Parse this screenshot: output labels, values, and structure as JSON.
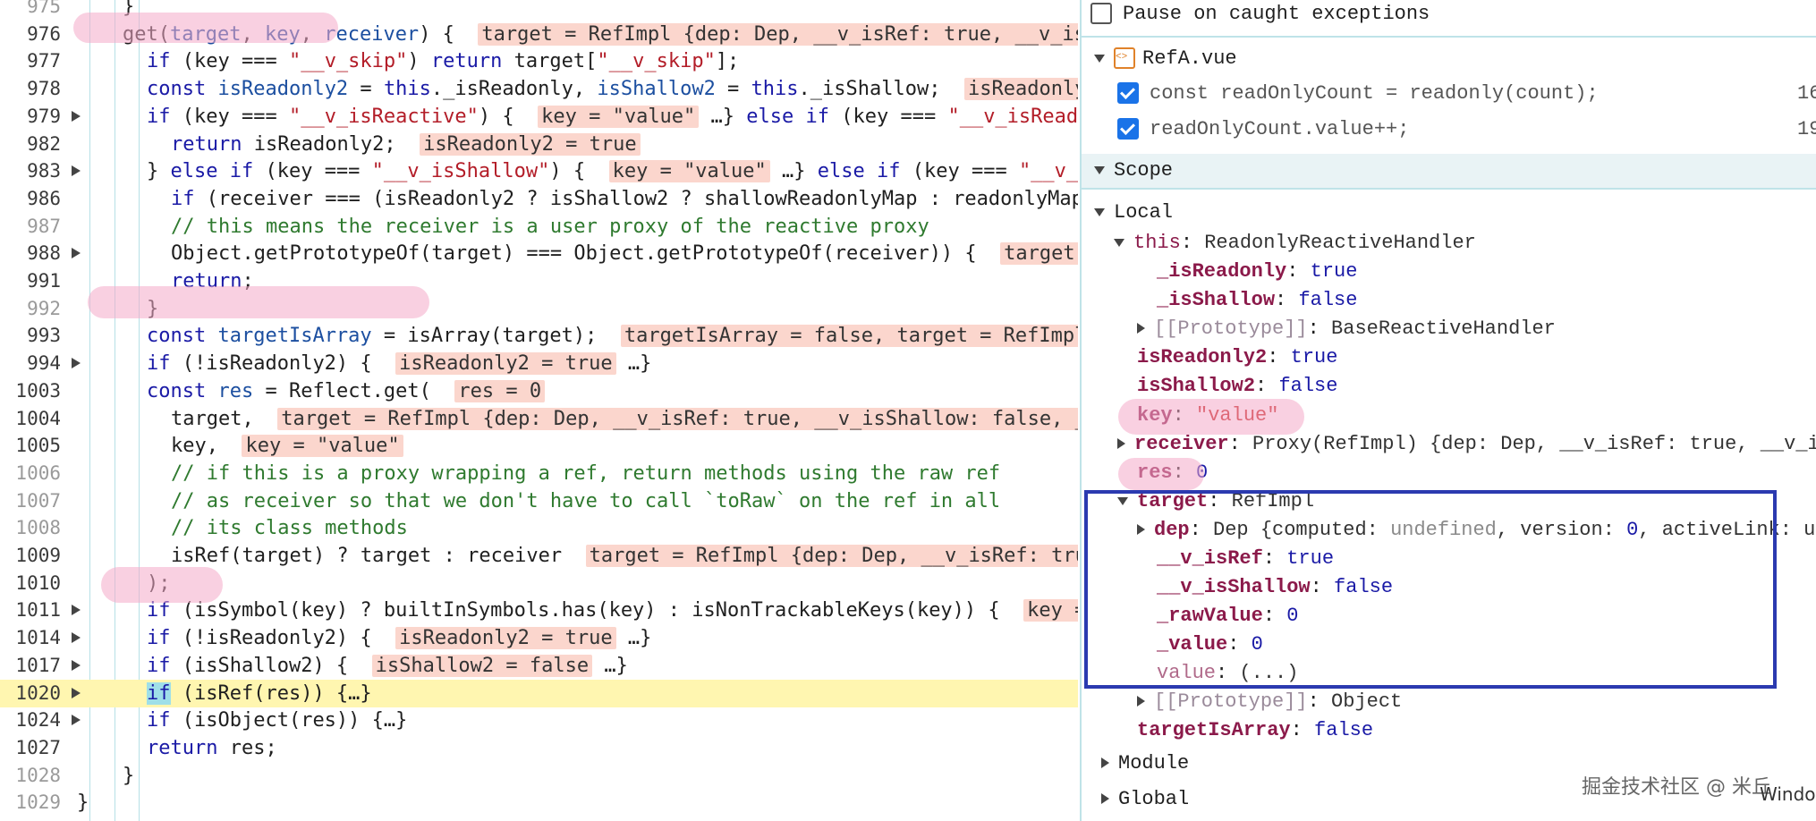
{
  "editor": {
    "lines": [
      {
        "n": "975",
        "dim": true,
        "fold": false,
        "indent": 0,
        "segs": [
          {
            "t": "}",
            "c": ""
          }
        ]
      },
      {
        "n": "976",
        "dim": false,
        "fold": false,
        "indent": 0,
        "segs": [
          {
            "t": "get(",
            "c": ""
          },
          {
            "t": "target",
            "c": "id"
          },
          {
            "t": ", ",
            "c": ""
          },
          {
            "t": "key",
            "c": "id"
          },
          {
            "t": ", ",
            "c": ""
          },
          {
            "t": "receiver",
            "c": "id"
          },
          {
            "t": ") {  ",
            "c": ""
          },
          {
            "t": "target = RefImpl {dep: Dep, __v_isRef: true, __v_is",
            "c": "val"
          }
        ]
      },
      {
        "n": "977",
        "dim": false,
        "fold": false,
        "indent": 1,
        "segs": [
          {
            "t": "if",
            "c": "kw"
          },
          {
            "t": " (key === ",
            "c": ""
          },
          {
            "t": "\"__v_skip\"",
            "c": "str"
          },
          {
            "t": ") ",
            "c": ""
          },
          {
            "t": "return",
            "c": "kw"
          },
          {
            "t": " target[",
            "c": ""
          },
          {
            "t": "\"__v_skip\"",
            "c": "str"
          },
          {
            "t": "];",
            "c": ""
          }
        ]
      },
      {
        "n": "978",
        "dim": false,
        "fold": false,
        "indent": 1,
        "segs": [
          {
            "t": "const",
            "c": "kw"
          },
          {
            "t": " ",
            "c": ""
          },
          {
            "t": "isReadonly2",
            "c": "id"
          },
          {
            "t": " = ",
            "c": ""
          },
          {
            "t": "this",
            "c": "kw"
          },
          {
            "t": "._isReadonly, ",
            "c": ""
          },
          {
            "t": "isShallow2",
            "c": "id"
          },
          {
            "t": " = ",
            "c": ""
          },
          {
            "t": "this",
            "c": "kw"
          },
          {
            "t": "._isShallow;  ",
            "c": ""
          },
          {
            "t": "isReadonly",
            "c": "val"
          }
        ]
      },
      {
        "n": "979",
        "dim": false,
        "fold": true,
        "indent": 1,
        "segs": [
          {
            "t": "if",
            "c": "kw"
          },
          {
            "t": " (key === ",
            "c": ""
          },
          {
            "t": "\"__v_isReactive\"",
            "c": "str"
          },
          {
            "t": ") {  ",
            "c": ""
          },
          {
            "t": "key = \"value\"",
            "c": "val"
          },
          {
            "t": " …} ",
            "c": ""
          },
          {
            "t": "else if",
            "c": "kw"
          },
          {
            "t": " (key === ",
            "c": ""
          },
          {
            "t": "\"__v_isRead",
            "c": "str"
          }
        ]
      },
      {
        "n": "982",
        "dim": false,
        "fold": false,
        "indent": 2,
        "segs": [
          {
            "t": "return",
            "c": "kw"
          },
          {
            "t": " isReadonly2;  ",
            "c": ""
          },
          {
            "t": "isReadonly2 = true",
            "c": "val"
          }
        ]
      },
      {
        "n": "983",
        "dim": false,
        "fold": true,
        "indent": 1,
        "segs": [
          {
            "t": "} ",
            "c": ""
          },
          {
            "t": "else if",
            "c": "kw"
          },
          {
            "t": " (key === ",
            "c": ""
          },
          {
            "t": "\"__v_isShallow\"",
            "c": "str"
          },
          {
            "t": ") {  ",
            "c": ""
          },
          {
            "t": "key = \"value\"",
            "c": "val"
          },
          {
            "t": " …} ",
            "c": ""
          },
          {
            "t": "else if",
            "c": "kw"
          },
          {
            "t": " (key === ",
            "c": ""
          },
          {
            "t": "\"__v_",
            "c": "str"
          }
        ]
      },
      {
        "n": "986",
        "dim": false,
        "fold": false,
        "indent": 2,
        "segs": [
          {
            "t": "if",
            "c": "kw"
          },
          {
            "t": " (receiver === (isReadonly2 ? isShallow2 ? shallowReadonlyMap : readonlyMap",
            "c": ""
          }
        ]
      },
      {
        "n": "987",
        "dim": true,
        "fold": false,
        "indent": 2,
        "segs": [
          {
            "t": "// this means the receiver is a user proxy of the reactive proxy",
            "c": "com"
          }
        ]
      },
      {
        "n": "988",
        "dim": false,
        "fold": true,
        "indent": 2,
        "segs": [
          {
            "t": "Object.getPrototypeOf(target) === Object.getPrototypeOf(receiver)) {  ",
            "c": ""
          },
          {
            "t": "target",
            "c": "val"
          }
        ]
      },
      {
        "n": "991",
        "dim": false,
        "fold": false,
        "indent": 2,
        "segs": [
          {
            "t": "return",
            "c": "kw"
          },
          {
            "t": ";",
            "c": ""
          }
        ]
      },
      {
        "n": "992",
        "dim": true,
        "fold": false,
        "indent": 1,
        "segs": [
          {
            "t": "}",
            "c": ""
          }
        ]
      },
      {
        "n": "993",
        "dim": false,
        "fold": false,
        "indent": 1,
        "segs": [
          {
            "t": "const",
            "c": "kw"
          },
          {
            "t": " ",
            "c": ""
          },
          {
            "t": "targetIsArray",
            "c": "id"
          },
          {
            "t": " = isArray(target);  ",
            "c": ""
          },
          {
            "t": "targetIsArray = false, target = RefImpl",
            "c": "val"
          }
        ]
      },
      {
        "n": "994",
        "dim": false,
        "fold": true,
        "indent": 1,
        "segs": [
          {
            "t": "if",
            "c": "kw"
          },
          {
            "t": " (!isReadonly2) {  ",
            "c": ""
          },
          {
            "t": "isReadonly2 = true",
            "c": "val"
          },
          {
            "t": " …}",
            "c": ""
          }
        ]
      },
      {
        "n": "1003",
        "dim": false,
        "fold": false,
        "indent": 1,
        "segs": [
          {
            "t": "const",
            "c": "kw"
          },
          {
            "t": " ",
            "c": ""
          },
          {
            "t": "res",
            "c": "id"
          },
          {
            "t": " = Reflect.get(  ",
            "c": ""
          },
          {
            "t": "res = 0",
            "c": "val"
          }
        ]
      },
      {
        "n": "1004",
        "dim": false,
        "fold": false,
        "indent": 2,
        "segs": [
          {
            "t": "target,  ",
            "c": ""
          },
          {
            "t": "target = RefImpl {dep: Dep, __v_isRef: true, __v_isShallow: false, _",
            "c": "val"
          }
        ]
      },
      {
        "n": "1005",
        "dim": false,
        "fold": false,
        "indent": 2,
        "segs": [
          {
            "t": "key,  ",
            "c": ""
          },
          {
            "t": "key = \"value\"",
            "c": "val"
          }
        ]
      },
      {
        "n": "1006",
        "dim": true,
        "fold": false,
        "indent": 2,
        "segs": [
          {
            "t": "// if this is a proxy wrapping a ref, return methods using the raw ref",
            "c": "com"
          }
        ]
      },
      {
        "n": "1007",
        "dim": true,
        "fold": false,
        "indent": 2,
        "segs": [
          {
            "t": "// as receiver so that we don't have to call `toRaw` on the ref in all",
            "c": "com"
          }
        ]
      },
      {
        "n": "1008",
        "dim": true,
        "fold": false,
        "indent": 2,
        "segs": [
          {
            "t": "// its class methods",
            "c": "com"
          }
        ]
      },
      {
        "n": "1009",
        "dim": false,
        "fold": false,
        "indent": 2,
        "segs": [
          {
            "t": "isRef(target) ? target : receiver  ",
            "c": ""
          },
          {
            "t": "target = RefImpl {dep: Dep, __v_isRef: tru",
            "c": "val"
          }
        ]
      },
      {
        "n": "1010",
        "dim": false,
        "fold": false,
        "indent": 1,
        "segs": [
          {
            "t": ");",
            "c": ""
          }
        ]
      },
      {
        "n": "1011",
        "dim": false,
        "fold": true,
        "indent": 1,
        "segs": [
          {
            "t": "if",
            "c": "kw"
          },
          {
            "t": " (isSymbol(key) ? builtInSymbols.has(key) : isNonTrackableKeys(key)) {  ",
            "c": ""
          },
          {
            "t": "key =",
            "c": "val"
          }
        ]
      },
      {
        "n": "1014",
        "dim": false,
        "fold": true,
        "indent": 1,
        "segs": [
          {
            "t": "if",
            "c": "kw"
          },
          {
            "t": " (!isReadonly2) {  ",
            "c": ""
          },
          {
            "t": "isReadonly2 = true",
            "c": "val"
          },
          {
            "t": " …}",
            "c": ""
          }
        ]
      },
      {
        "n": "1017",
        "dim": false,
        "fold": true,
        "indent": 1,
        "segs": [
          {
            "t": "if",
            "c": "kw"
          },
          {
            "t": " (isShallow2) {  ",
            "c": ""
          },
          {
            "t": "isShallow2 = false",
            "c": "val"
          },
          {
            "t": " …}",
            "c": ""
          }
        ]
      },
      {
        "n": "1020",
        "dim": false,
        "fold": true,
        "indent": 1,
        "current": true,
        "segs": [
          {
            "t": "if",
            "c": "sel"
          },
          {
            "t": " (isRef(res)) {…}",
            "c": ""
          }
        ]
      },
      {
        "n": "1024",
        "dim": false,
        "fold": true,
        "indent": 1,
        "segs": [
          {
            "t": "if",
            "c": "kw"
          },
          {
            "t": " (isObject(res)) {…}",
            "c": ""
          }
        ]
      },
      {
        "n": "1027",
        "dim": false,
        "fold": false,
        "indent": 1,
        "segs": [
          {
            "t": "return",
            "c": "kw"
          },
          {
            "t": " res;",
            "c": ""
          }
        ]
      },
      {
        "n": "1028",
        "dim": true,
        "fold": false,
        "indent": 0,
        "segs": [
          {
            "t": "}",
            "c": ""
          }
        ]
      },
      {
        "n": "1029",
        "dim": true,
        "fold": false,
        "indent": -1,
        "segs": [
          {
            "t": "}",
            "c": ""
          }
        ]
      }
    ]
  },
  "debugger": {
    "pause_caught_label": "Pause on caught exceptions",
    "file_name": "RefA.vue",
    "breakpoints": [
      {
        "code": "const readOnlyCount = readonly(count);",
        "line": "16"
      },
      {
        "code": "readOnlyCount.value++;",
        "line": "19"
      }
    ],
    "scope_label": "Scope",
    "local_label": "Local",
    "module_label": "Module",
    "global_label": "Global",
    "window_label": "Windo",
    "vars": {
      "this_key": "this",
      "this_val": "ReadonlyReactiveHandler",
      "isReadonly_key": "_isReadonly",
      "isReadonly_val": "true",
      "isShallow_key": "_isShallow",
      "isShallow_val": "false",
      "proto1_key": "[[Prototype]]",
      "proto1_val": "BaseReactiveHandler",
      "isReadonly2_key": "isReadonly2",
      "isReadonly2_val": "true",
      "isShallow2_key": "isShallow2",
      "isShallow2_val": "false",
      "key_key": "key",
      "key_val": "\"value\"",
      "receiver_key": "receiver",
      "receiver_val": "Proxy(RefImpl) {dep: Dep, __v_isRef: true, __v_i",
      "res_key": "res",
      "res_val": "0",
      "target_key": "target",
      "target_val": "RefImpl",
      "dep_key": "dep",
      "dep_val_pre": "Dep {computed: ",
      "dep_val_undef": "undefined",
      "dep_val_mid": ", version: ",
      "dep_val_num": "0",
      "dep_val_post": ", activeLink: u",
      "vIsRef_key": "__v_isRef",
      "vIsRef_val": "true",
      "vIsShallow_key": "__v_isShallow",
      "vIsShallow_val": "false",
      "rawValue_key": "_rawValue",
      "rawValue_val": "0",
      "value_key": "_value",
      "value_val": "0",
      "valueGetter_key": "value",
      "valueGetter_val": "(...)",
      "proto2_key": "[[Prototype]]",
      "proto2_val": "Object",
      "targetIsArray_key": "targetIsArray",
      "targetIsArray_val": "false"
    }
  },
  "watermark": "掘金技术社区 @ 米丘",
  "colors": {
    "annotation_pink": "#f4aac8",
    "annotation_blue": "#2b3ab0",
    "current_line": "#fff6b0"
  }
}
